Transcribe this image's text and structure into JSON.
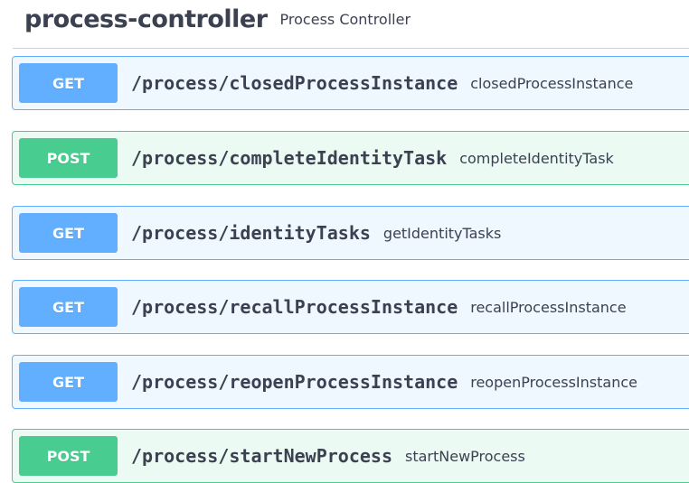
{
  "tag": {
    "name": "process-controller",
    "description": "Process Controller"
  },
  "operations": [
    {
      "method": "GET",
      "path": "/process/closedProcessInstance",
      "summary": "closedProcessInstance"
    },
    {
      "method": "POST",
      "path": "/process/completeIdentityTask",
      "summary": "completeIdentityTask"
    },
    {
      "method": "GET",
      "path": "/process/identityTasks",
      "summary": "getIdentityTasks"
    },
    {
      "method": "GET",
      "path": "/process/recallProcessInstance",
      "summary": "recallProcessInstance"
    },
    {
      "method": "GET",
      "path": "/process/reopenProcessInstance",
      "summary": "reopenProcessInstance"
    },
    {
      "method": "POST",
      "path": "/process/startNewProcess",
      "summary": "startNewProcess"
    }
  ],
  "colors": {
    "get": "#61affe",
    "post": "#49cc90",
    "text": "#3b4151"
  }
}
